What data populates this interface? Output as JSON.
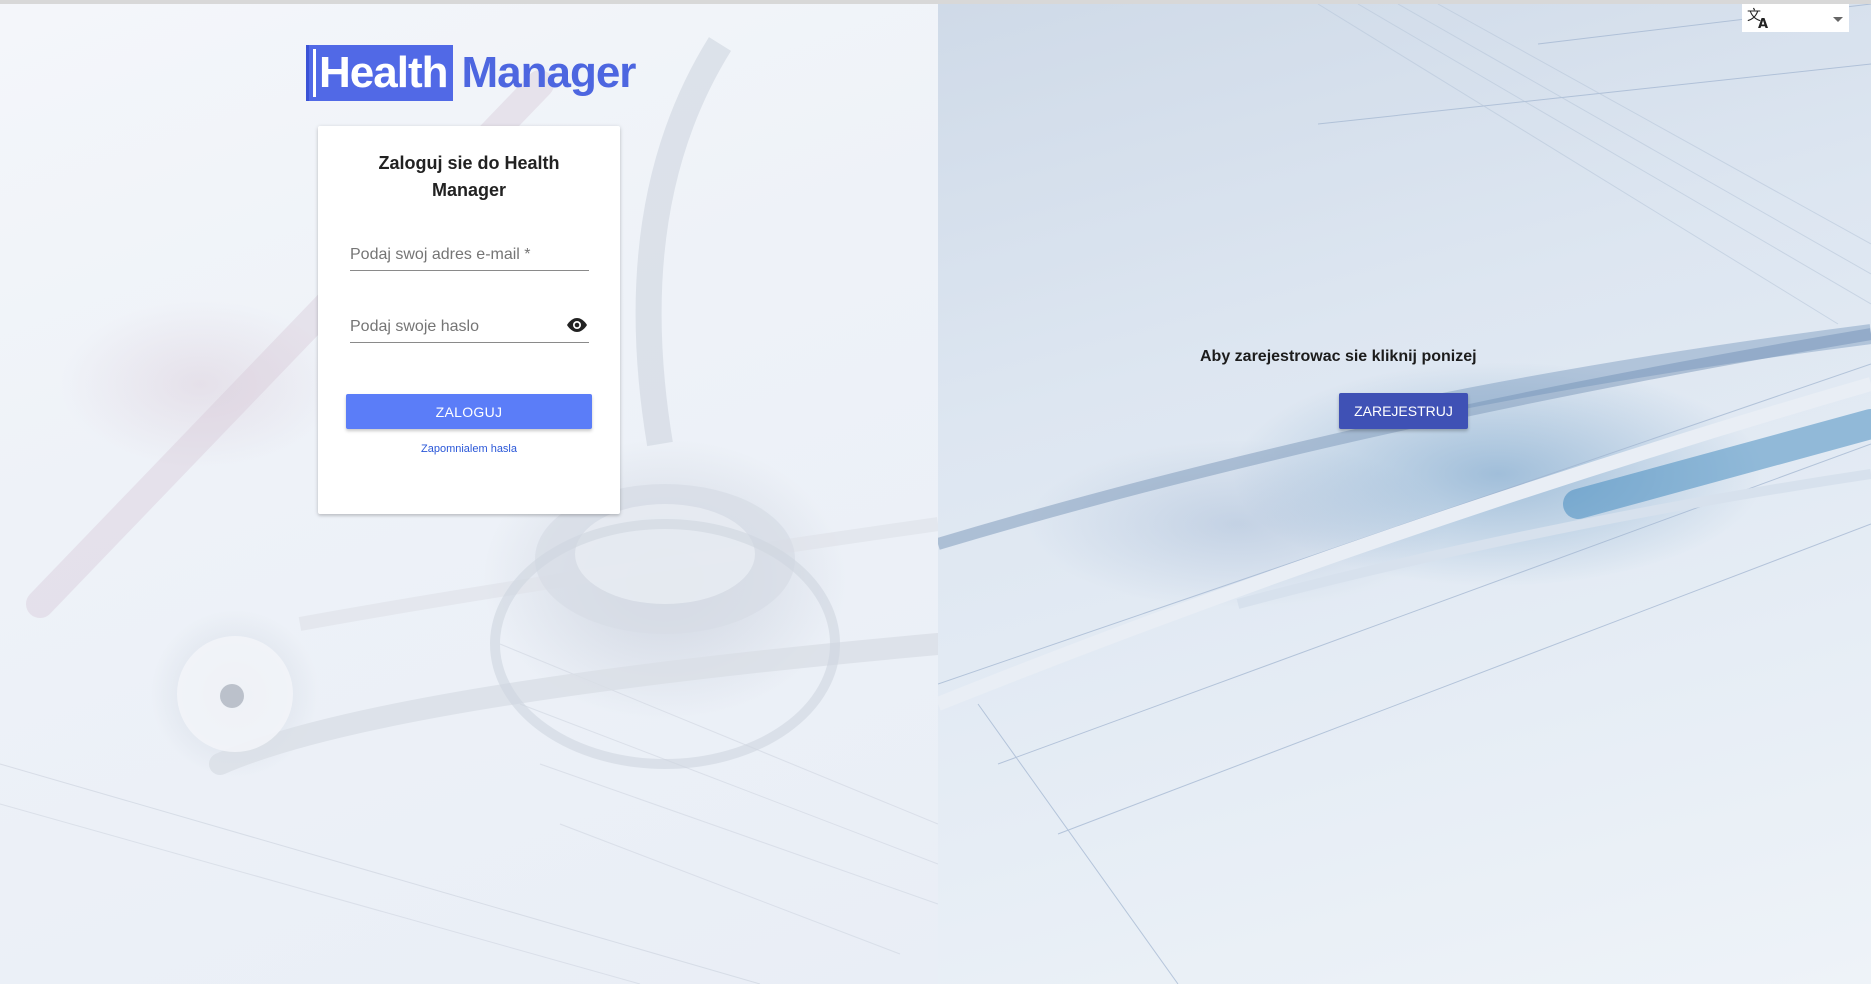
{
  "app": {
    "logo_boxed": "Health",
    "logo_rest": "Manager"
  },
  "login": {
    "title": "Zaloguj sie do Health Manager",
    "email_placeholder": "Podaj swoj adres e-mail *",
    "password_placeholder": "Podaj swoje haslo",
    "submit_label": "ZALOGUJ",
    "forgot_label": "Zapomnialem hasla"
  },
  "register": {
    "prompt": "Aby zarejestrowac sie kliknij ponizej",
    "button_label": "ZAREJESTRUJ"
  },
  "language_select": {
    "icon": "translate-icon",
    "value": ""
  },
  "icons": {
    "password_toggle": "eye-icon",
    "language": "translate-icon",
    "dropdown": "caret-down-icon"
  },
  "colors": {
    "brand": "#5169e6",
    "login_button": "#5b7df8",
    "register_button": "#3f51b5",
    "link": "#2a57d8"
  }
}
